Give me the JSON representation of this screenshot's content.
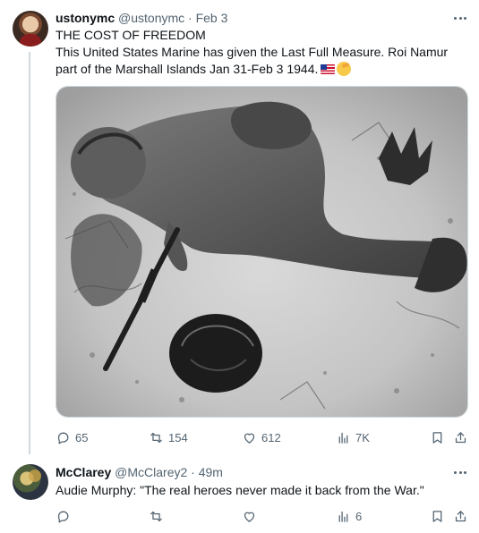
{
  "tweets": [
    {
      "name": "ustonymc",
      "handle": "@ustonymc",
      "separator": "·",
      "time": "Feb 3",
      "title_line": "THE COST OF FREEDOM",
      "text": "This United States Marine has given the Last Full Measure. Roi Namur part of the Marshall Islands Jan 31-Feb 3 1944.",
      "emojis": [
        "us-flag",
        "saluting-face"
      ],
      "media": {
        "type": "photo",
        "description_icon": "black-and-white-photo"
      },
      "stats": {
        "replies": "65",
        "reposts": "154",
        "likes": "612",
        "views": "7K"
      }
    },
    {
      "name": "McClarey",
      "handle": "@McClarey2",
      "separator": "·",
      "time": "49m",
      "text": "Audie Murphy:  \"The real heroes never made it back from the War.\"",
      "stats": {
        "replies": "",
        "reposts": "",
        "likes": "",
        "views": "6"
      }
    }
  ],
  "colors": {
    "text": "#0f1419",
    "secondary": "#536471",
    "border": "#cfd9de",
    "background": "#ffffff"
  },
  "icons": [
    "reply-icon",
    "repost-icon",
    "like-icon",
    "views-icon",
    "bookmark-icon",
    "share-icon",
    "more-icon"
  ]
}
